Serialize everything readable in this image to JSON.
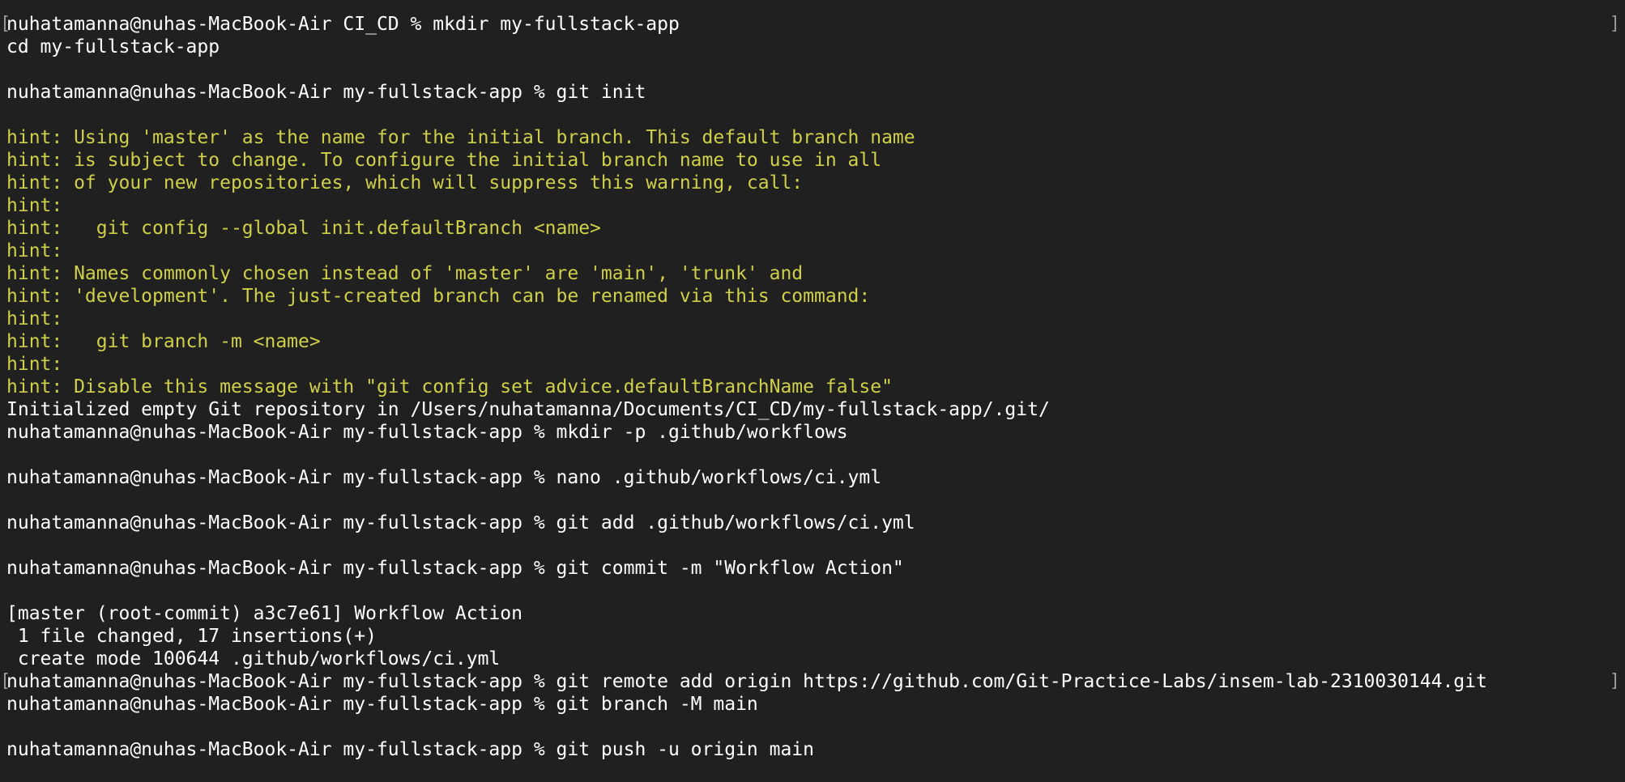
{
  "colors": {
    "background": "#202020",
    "text": "#ffffff",
    "hint": "#cfcf4a",
    "bracket": "#9a9a9a"
  },
  "terminal": {
    "lines": [
      {
        "text": "nuhatamanna@nuhas-MacBook-Air CI_CD % mkdir my-fullstack-app",
        "type": "command"
      },
      {
        "text": "cd my-fullstack-app",
        "type": "command"
      },
      {
        "text": "",
        "type": "blank"
      },
      {
        "text": "nuhatamanna@nuhas-MacBook-Air my-fullstack-app % git init",
        "type": "command"
      },
      {
        "text": "",
        "type": "blank"
      },
      {
        "text": "hint: Using 'master' as the name for the initial branch. This default branch name",
        "type": "hint"
      },
      {
        "text": "hint: is subject to change. To configure the initial branch name to use in all",
        "type": "hint"
      },
      {
        "text": "hint: of your new repositories, which will suppress this warning, call:",
        "type": "hint"
      },
      {
        "text": "hint:",
        "type": "hint"
      },
      {
        "text": "hint:   git config --global init.defaultBranch <name>",
        "type": "hint"
      },
      {
        "text": "hint:",
        "type": "hint"
      },
      {
        "text": "hint: Names commonly chosen instead of 'master' are 'main', 'trunk' and",
        "type": "hint"
      },
      {
        "text": "hint: 'development'. The just-created branch can be renamed via this command:",
        "type": "hint"
      },
      {
        "text": "hint:",
        "type": "hint"
      },
      {
        "text": "hint:   git branch -m <name>",
        "type": "hint"
      },
      {
        "text": "hint:",
        "type": "hint"
      },
      {
        "text": "hint: Disable this message with \"git config set advice.defaultBranchName false\"",
        "type": "hint"
      },
      {
        "text": "Initialized empty Git repository in /Users/nuhatamanna/Documents/CI_CD/my-fullstack-app/.git/",
        "type": "output"
      },
      {
        "text": "nuhatamanna@nuhas-MacBook-Air my-fullstack-app % mkdir -p .github/workflows",
        "type": "command"
      },
      {
        "text": "",
        "type": "blank"
      },
      {
        "text": "nuhatamanna@nuhas-MacBook-Air my-fullstack-app % nano .github/workflows/ci.yml",
        "type": "command"
      },
      {
        "text": "",
        "type": "blank"
      },
      {
        "text": "nuhatamanna@nuhas-MacBook-Air my-fullstack-app % git add .github/workflows/ci.yml",
        "type": "command"
      },
      {
        "text": "",
        "type": "blank"
      },
      {
        "text": "nuhatamanna@nuhas-MacBook-Air my-fullstack-app % git commit -m \"Workflow Action\"",
        "type": "command"
      },
      {
        "text": "",
        "type": "blank"
      },
      {
        "text": "[master (root-commit) a3c7e61] Workflow Action",
        "type": "output"
      },
      {
        "text": " 1 file changed, 17 insertions(+)",
        "type": "output"
      },
      {
        "text": " create mode 100644 .github/workflows/ci.yml",
        "type": "output"
      },
      {
        "text": "nuhatamanna@nuhas-MacBook-Air my-fullstack-app % git remote add origin https://github.com/Git-Practice-Labs/insem-lab-2310030144.git",
        "type": "command"
      },
      {
        "text": "nuhatamanna@nuhas-MacBook-Air my-fullstack-app % git branch -M main",
        "type": "command"
      },
      {
        "text": "",
        "type": "blank"
      },
      {
        "text": "nuhatamanna@nuhas-MacBook-Air my-fullstack-app % git push -u origin main",
        "type": "command"
      }
    ],
    "brackets": {
      "left": "[",
      "right": "]"
    }
  }
}
